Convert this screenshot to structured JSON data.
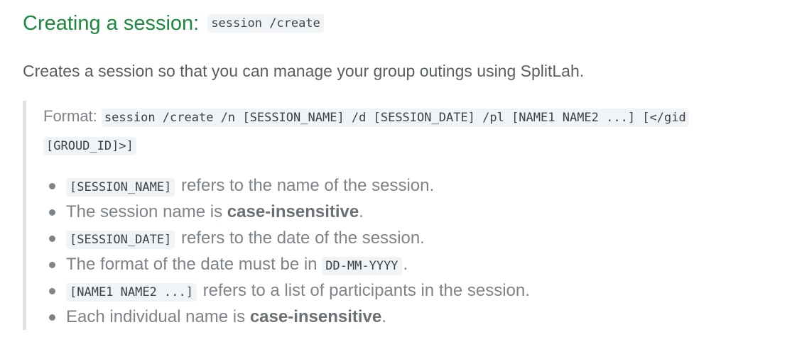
{
  "section": {
    "heading_text": "Creating a session:",
    "heading_code": "session /create",
    "description": "Creates a session so that you can manage your group outings using SplitLah."
  },
  "format": {
    "label": "Format:",
    "code_line1": "session /create /n [SESSION_NAME] /d [SESSION_DATE] /pl [NAME1 NAME2 ...] [</gid",
    "code_line2": "[GROUD_ID]>]"
  },
  "notes": [
    {
      "code": "[SESSION_NAME]",
      "text": " refers to the name of the session."
    },
    {
      "text_before": "The session name is ",
      "bold": "case-insensitive",
      "text_after": "."
    },
    {
      "code": "[SESSION_DATE]",
      "text": " refers to the date of the session."
    },
    {
      "text_before": "The format of the date must be in ",
      "code": "DD-MM-YYYY",
      "text_after": "."
    },
    {
      "code": "[NAME1 NAME2 ...]",
      "text": " refers to a list of participants in the session."
    },
    {
      "text_before": "Each individual name is ",
      "bold": "case-insensitive",
      "text_after": "."
    }
  ]
}
